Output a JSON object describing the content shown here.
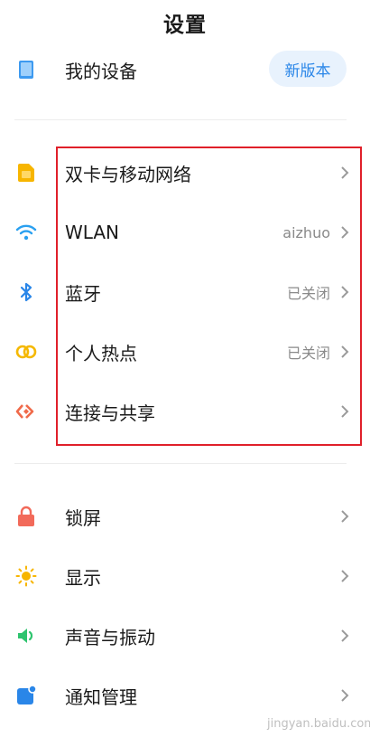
{
  "header": {
    "title": "设置"
  },
  "device": {
    "label": "我的设备",
    "badge": "新版本"
  },
  "network_group": [
    {
      "label": "双卡与移动网络",
      "value": "",
      "icon": "sim-card-icon"
    },
    {
      "label": "WLAN",
      "value": "aizhuo",
      "icon": "wifi-icon"
    },
    {
      "label": "蓝牙",
      "value": "已关闭",
      "icon": "bluetooth-icon"
    },
    {
      "label": "个人热点",
      "value": "已关闭",
      "icon": "hotspot-icon"
    },
    {
      "label": "连接与共享",
      "value": "",
      "icon": "share-icon"
    }
  ],
  "display_group": [
    {
      "label": "锁屏",
      "icon": "lock-icon"
    },
    {
      "label": "显示",
      "icon": "sun-icon"
    },
    {
      "label": "声音与振动",
      "icon": "speaker-icon"
    },
    {
      "label": "通知管理",
      "icon": "notification-icon"
    }
  ],
  "colors": {
    "accent": "#2a86e8",
    "highlight": "#e0202a",
    "sim": "#f7b500",
    "wifi": "#2aa0f0",
    "bluetooth": "#2a86e8",
    "hotspot": "#f5b800",
    "share": "#f06a4a",
    "lock": "#f26a5a",
    "display": "#f7b500",
    "sound": "#2ec46e",
    "notify": "#2a86e8"
  },
  "watermark": {
    "text": "jingyan.baidu.com"
  }
}
